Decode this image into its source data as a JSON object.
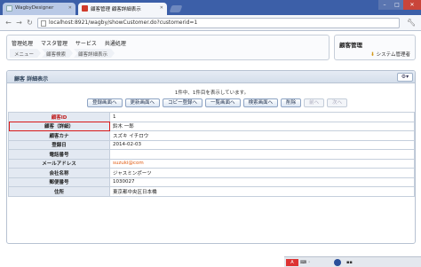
{
  "browser": {
    "tabs": [
      {
        "title": "WagbyDesigner"
      },
      {
        "title": "顧客管理 顧客詳細表示"
      }
    ],
    "url": "localhost:8921/wagby/showCustomer.do?customerid=1"
  },
  "menu": {
    "items": [
      "管理処理",
      "マスタ管理",
      "サービス",
      "共通処理"
    ],
    "breadcrumb": [
      "メニュー",
      "顧客検索",
      "顧客詳細表示"
    ]
  },
  "admin": {
    "title": "顧客管理",
    "user_label": "システム管理者"
  },
  "panel": {
    "title": "顧客 詳細表示",
    "count_text": "1件中、1件目を表示しています。",
    "buttons": [
      {
        "label": "登録画面へ",
        "enabled": true
      },
      {
        "label": "更新画面へ",
        "enabled": true
      },
      {
        "label": "コピー登録へ",
        "enabled": true
      },
      {
        "label": "一覧画面へ",
        "enabled": true
      },
      {
        "label": "検索画面へ",
        "enabled": true
      },
      {
        "label": "削除",
        "enabled": true
      },
      {
        "label": "前へ",
        "enabled": false
      },
      {
        "label": "次へ",
        "enabled": false
      }
    ],
    "rows": [
      {
        "label": "顧客ID",
        "value": "1"
      },
      {
        "label": "顧客（詳細）",
        "value": "鈴木 一郎"
      },
      {
        "label": "顧客カナ",
        "value": "スズキ イチロウ"
      },
      {
        "label": "登録日",
        "value": "2014-02-03"
      },
      {
        "label": "電話番号",
        "value": ""
      },
      {
        "label": "メールアドレス",
        "value": "suzuki@com"
      },
      {
        "label": "会社名称",
        "value": "ジャスミンポーツ"
      },
      {
        "label": "郵便番号",
        "value": "1030027"
      },
      {
        "label": "住所",
        "value": "東京都中央区日本橋"
      }
    ]
  },
  "colors": {
    "header_bar": "#3c5fa8",
    "label_bg": "#e3e9f2",
    "highlight_red": "#d81818"
  }
}
